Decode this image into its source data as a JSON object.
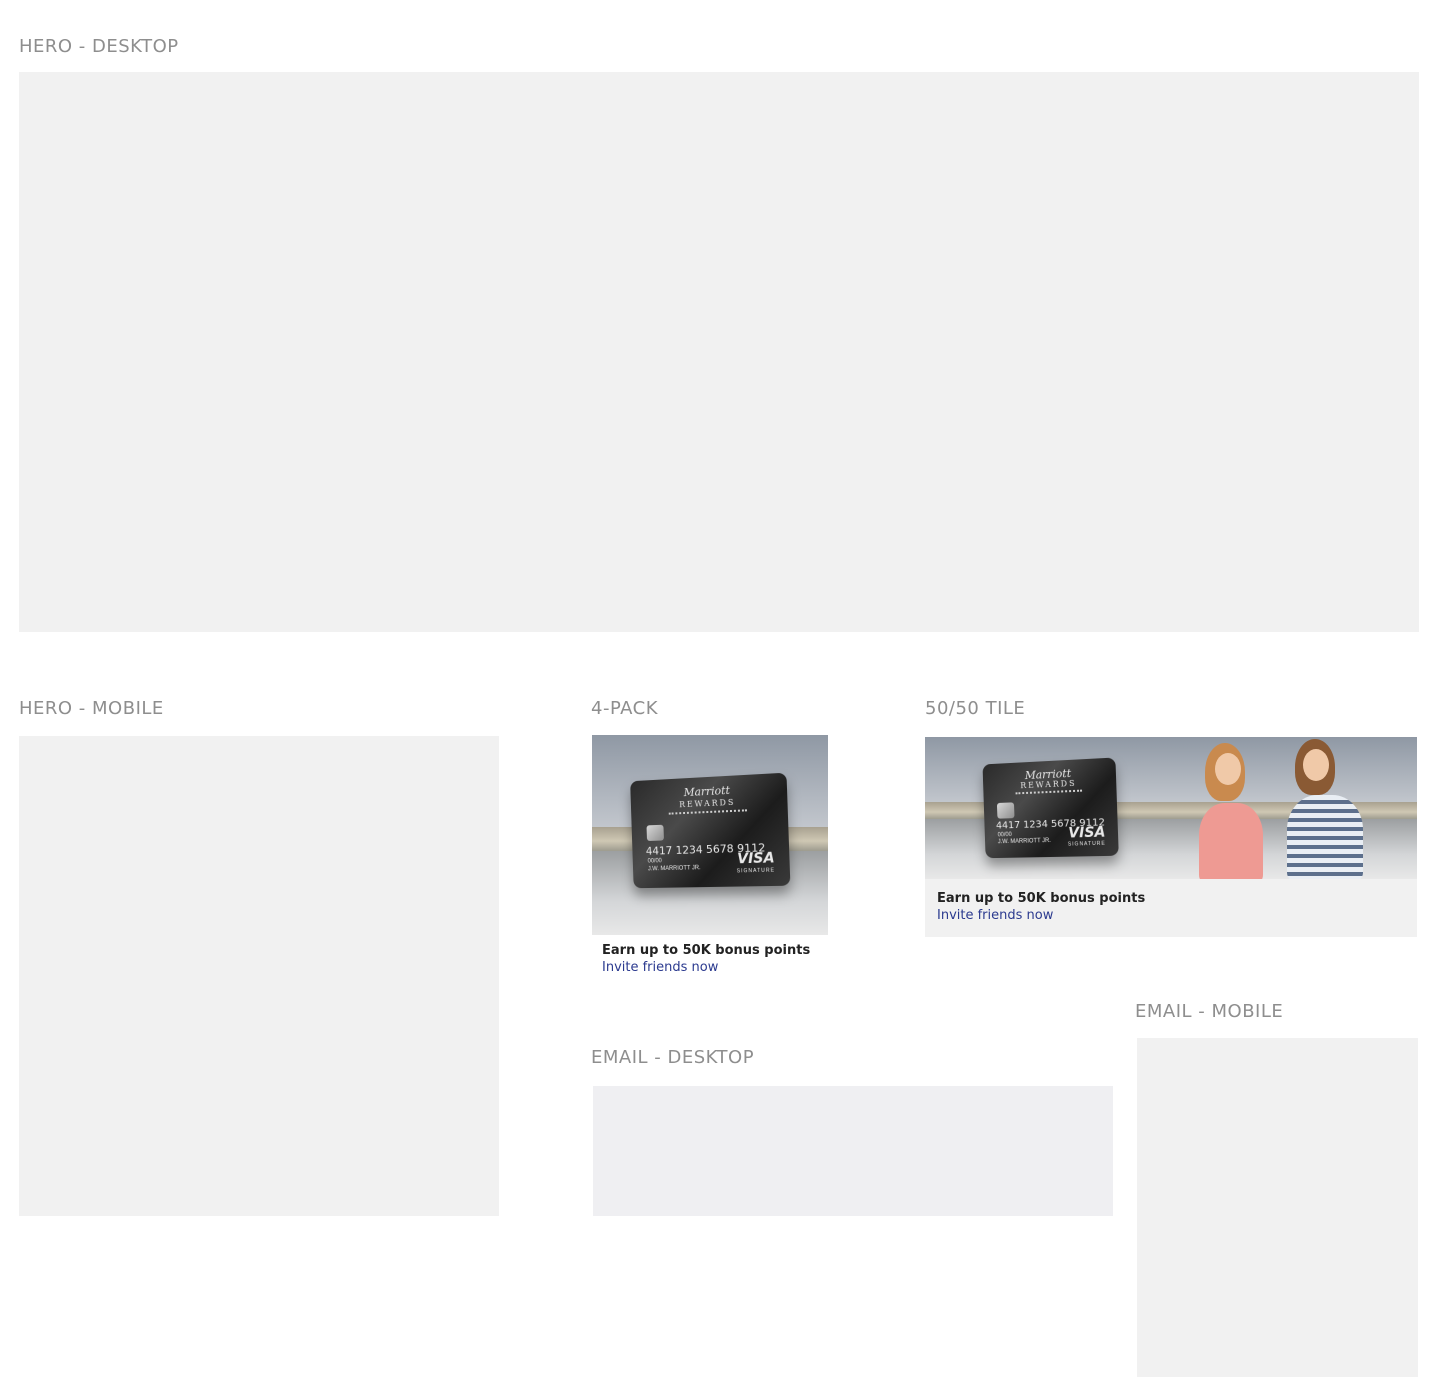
{
  "sections": {
    "hero_desktop": {
      "label": "HERO - DESKTOP"
    },
    "hero_mobile": {
      "label": "HERO - MOBILE"
    },
    "four_pack": {
      "label": "4-PACK",
      "headline": "Earn up to 50K bonus points",
      "link": "Invite friends now"
    },
    "fifty_tile": {
      "label": "50/50 TILE",
      "headline": "Earn up to 50K bonus points",
      "link": "Invite friends now"
    },
    "email_desktop": {
      "label": "EMAIL - DESKTOP"
    },
    "email_mobile": {
      "label": "EMAIL - MOBILE"
    }
  },
  "card": {
    "brand": "Marriott",
    "brand_sub": "REWARDS",
    "number": "4417 1234 5678 9112",
    "expiry": "00/00",
    "holder": "J.W. MARRIOTT JR.",
    "network": "VISA",
    "network_sub": "SIGNATURE"
  },
  "colors": {
    "placeholder": "#f1f1f1",
    "label": "#8e8e8e",
    "link": "#2b3a8f"
  }
}
